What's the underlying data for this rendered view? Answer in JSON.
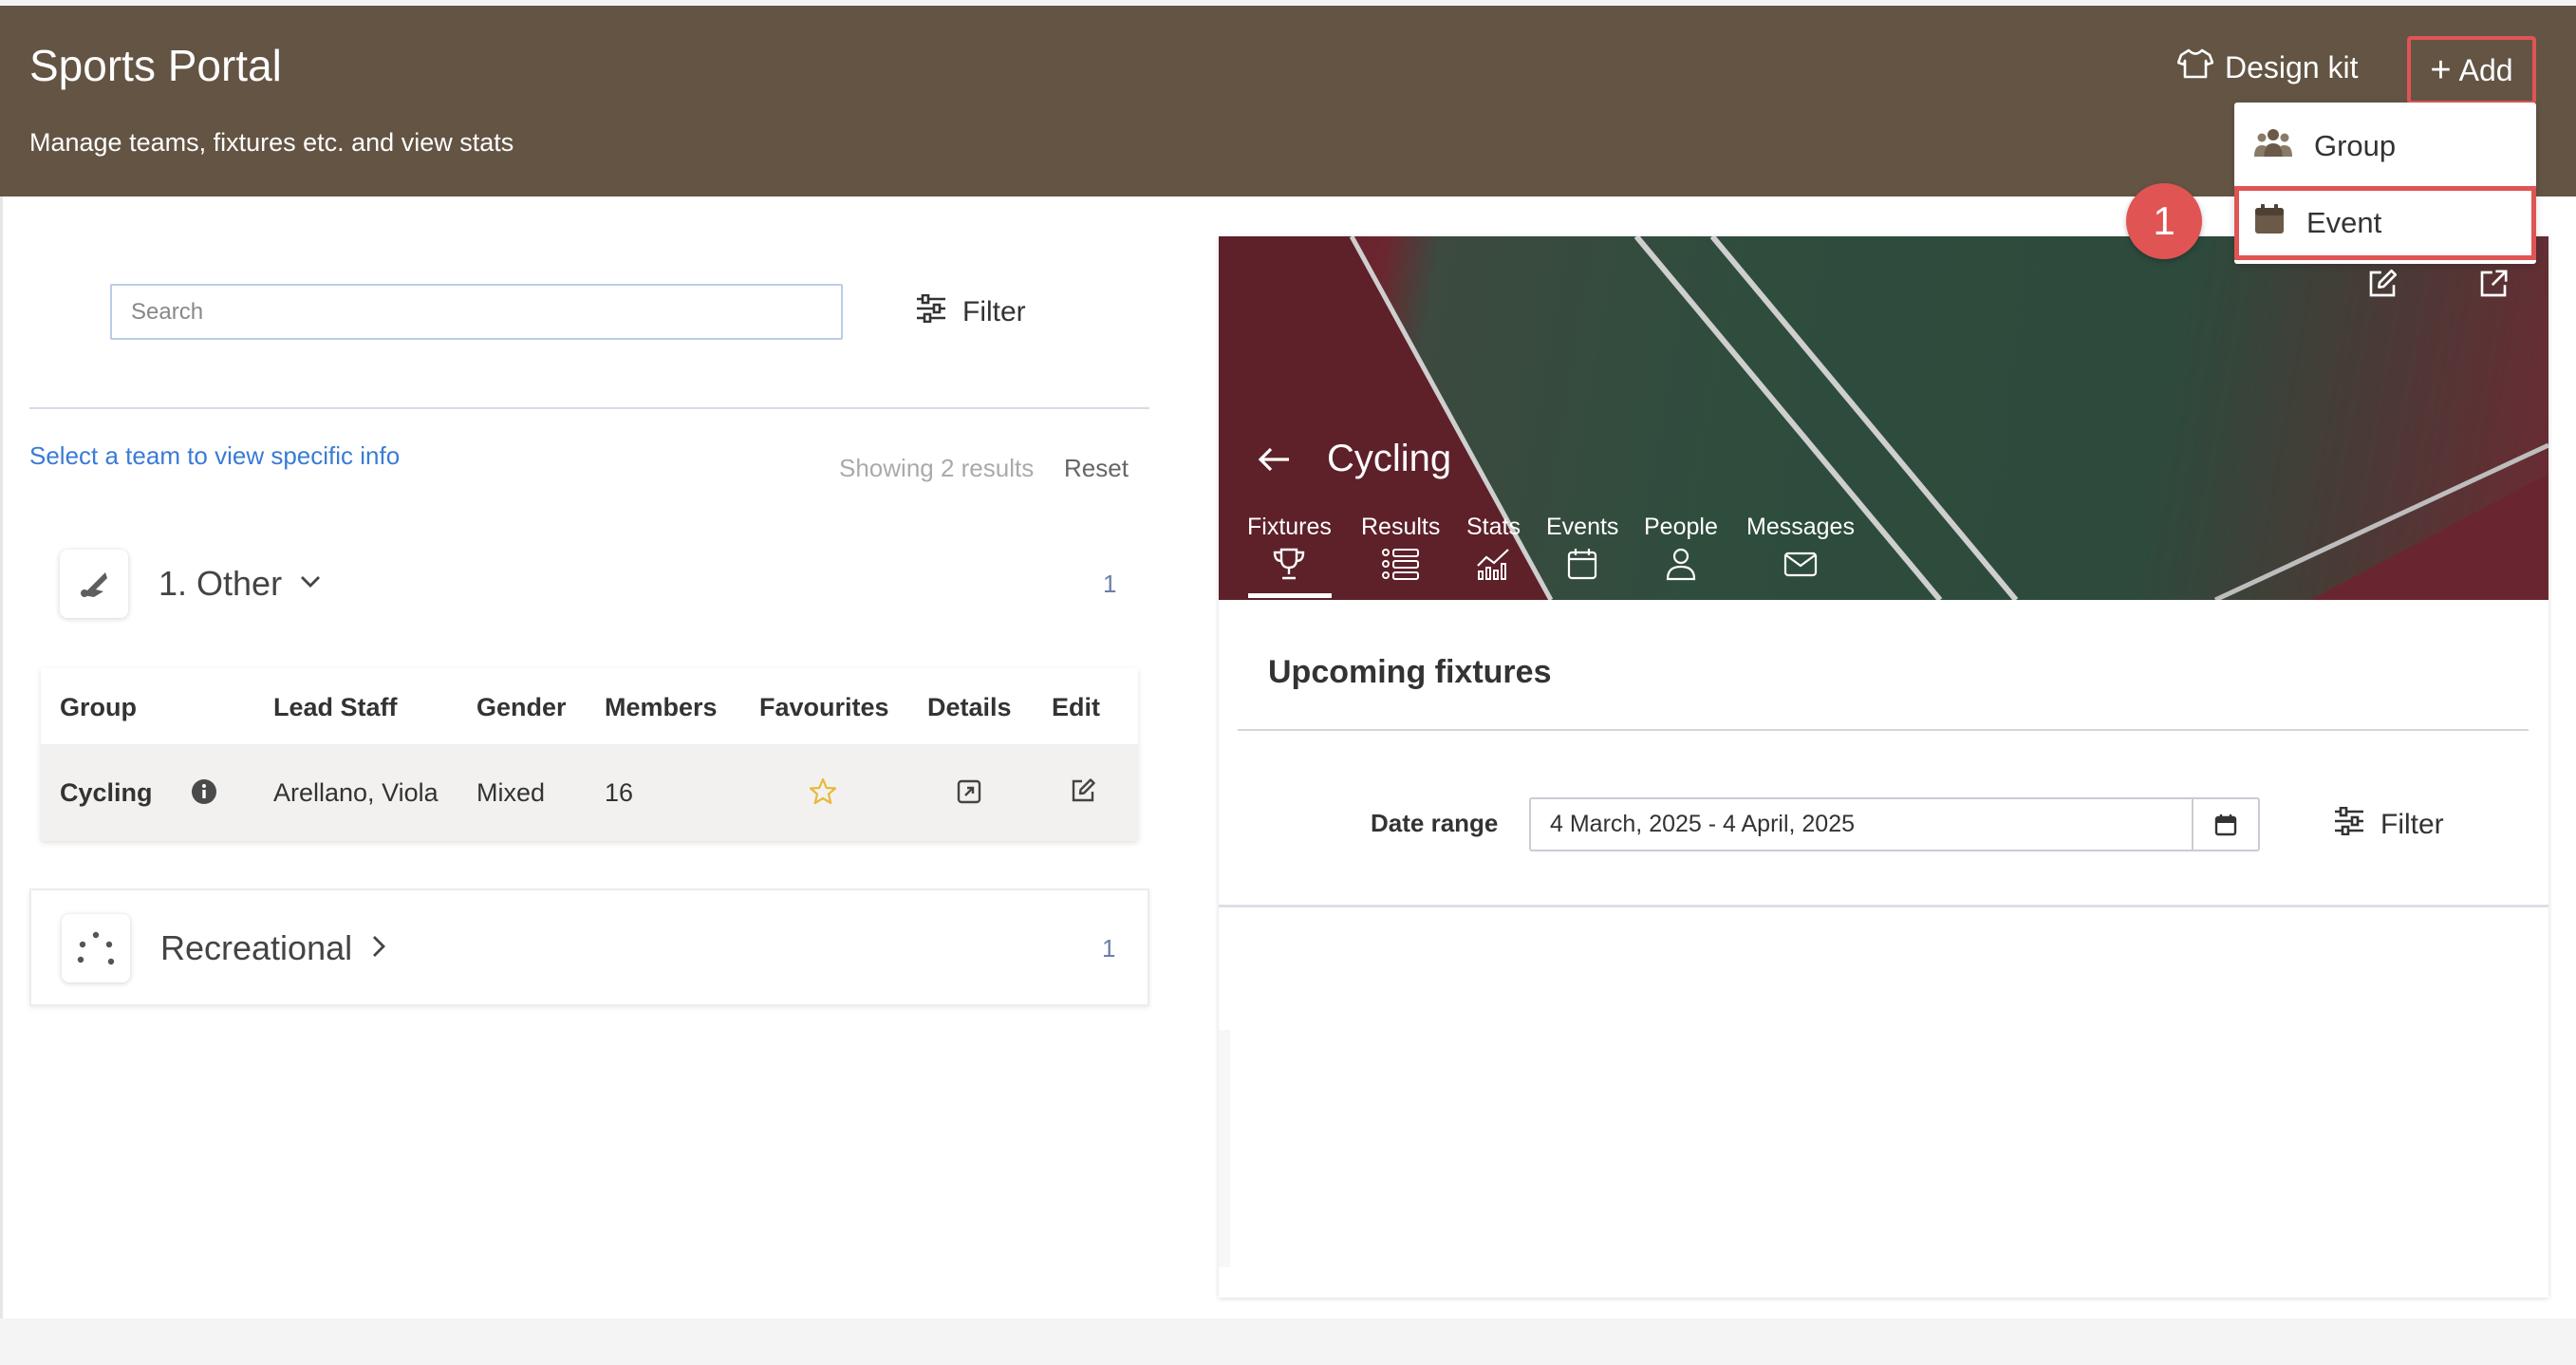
{
  "header": {
    "title": "Sports Portal",
    "subtitle": "Manage teams, fixtures etc. and view stats",
    "design_kit_label": "Design kit",
    "add_label": "Add"
  },
  "add_menu": {
    "items": [
      {
        "label": "Group",
        "icon": "group-icon"
      },
      {
        "label": "Event",
        "icon": "calendar-icon"
      }
    ],
    "callout_number": "1"
  },
  "left": {
    "search_placeholder": "Search",
    "filter_label": "Filter",
    "select_hint": "Select a team to view specific info",
    "showing": "Showing 2 results",
    "reset": "Reset",
    "groups": [
      {
        "name": "1. Other",
        "count": "1",
        "icon": "shuttlecock-icon",
        "expanded": true
      },
      {
        "name": "Recreational",
        "count": "1",
        "icon": "dots-icon",
        "expanded": false
      }
    ],
    "table": {
      "headers": [
        "Group",
        "Lead Staff",
        "Gender",
        "Members",
        "Favourites",
        "Details",
        "Edit"
      ],
      "rows": [
        {
          "group": "Cycling",
          "lead_staff": "Arellano, Viola",
          "gender": "Mixed",
          "members": "16"
        }
      ]
    }
  },
  "right": {
    "team_name": "Cycling",
    "tabs": [
      {
        "label": "Fixtures",
        "icon": "trophy-icon",
        "active": true
      },
      {
        "label": "Results",
        "icon": "results-icon"
      },
      {
        "label": "Stats",
        "icon": "stats-icon"
      },
      {
        "label": "Events",
        "icon": "calendar-icon"
      },
      {
        "label": "People",
        "icon": "person-icon"
      },
      {
        "label": "Messages",
        "icon": "envelope-icon"
      }
    ],
    "section_title": "Upcoming fixtures",
    "date_range_label": "Date range",
    "date_range_value": "4 March, 2025 - 4 April, 2025",
    "filter_label": "Filter"
  },
  "colors": {
    "header_bg": "#635444",
    "highlight": "#e05454",
    "link": "#3a7bd5",
    "star": "#e8b93a"
  }
}
